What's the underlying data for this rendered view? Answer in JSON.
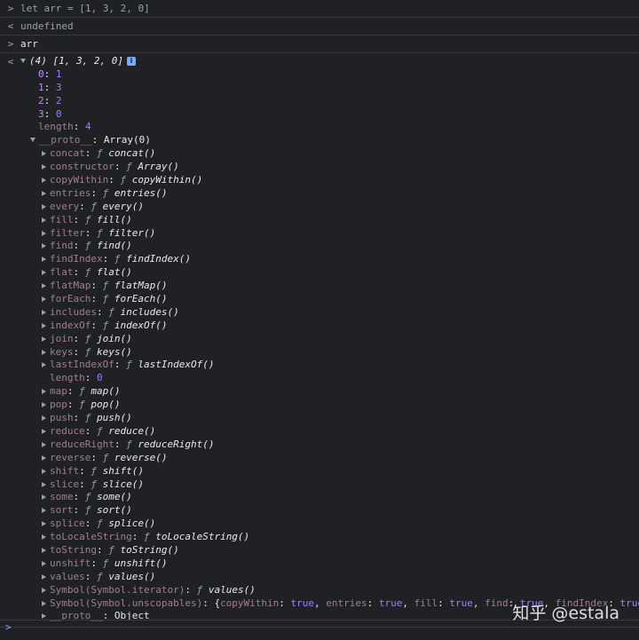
{
  "entries": {
    "input1": {
      "prompt": ">",
      "code_let": "let",
      "code_rest": " arr = [1, 3, 2, 0]"
    },
    "output1": {
      "prompt": "<",
      "text": "undefined"
    },
    "input2": {
      "prompt": ">",
      "text": "arr"
    },
    "output2": {
      "prompt": "<",
      "summary_count": "(4)",
      "summary_array": "[1, 3, 2, 0]",
      "info_badge": "i"
    }
  },
  "array_items": [
    {
      "key": "0",
      "value": "1"
    },
    {
      "key": "1",
      "value": "3"
    },
    {
      "key": "2",
      "value": "2"
    },
    {
      "key": "3",
      "value": "0"
    }
  ],
  "length_row": {
    "key": "length",
    "value": "4"
  },
  "proto": {
    "key": "__proto__",
    "value": "Array(0)"
  },
  "proto_methods": [
    {
      "key": "concat",
      "fn": "concat()"
    },
    {
      "key": "constructor",
      "fn": "Array()"
    },
    {
      "key": "copyWithin",
      "fn": "copyWithin()"
    },
    {
      "key": "entries",
      "fn": "entries()"
    },
    {
      "key": "every",
      "fn": "every()"
    },
    {
      "key": "fill",
      "fn": "fill()"
    },
    {
      "key": "filter",
      "fn": "filter()"
    },
    {
      "key": "find",
      "fn": "find()"
    },
    {
      "key": "findIndex",
      "fn": "findIndex()"
    },
    {
      "key": "flat",
      "fn": "flat()"
    },
    {
      "key": "flatMap",
      "fn": "flatMap()"
    },
    {
      "key": "forEach",
      "fn": "forEach()"
    },
    {
      "key": "includes",
      "fn": "includes()"
    },
    {
      "key": "indexOf",
      "fn": "indexOf()"
    },
    {
      "key": "join",
      "fn": "join()"
    },
    {
      "key": "keys",
      "fn": "keys()"
    },
    {
      "key": "lastIndexOf",
      "fn": "lastIndexOf()"
    }
  ],
  "proto_length": {
    "key": "length",
    "value": "0"
  },
  "proto_methods2": [
    {
      "key": "map",
      "fn": "map()"
    },
    {
      "key": "pop",
      "fn": "pop()"
    },
    {
      "key": "push",
      "fn": "push()"
    },
    {
      "key": "reduce",
      "fn": "reduce()"
    },
    {
      "key": "reduceRight",
      "fn": "reduceRight()"
    },
    {
      "key": "reverse",
      "fn": "reverse()"
    },
    {
      "key": "shift",
      "fn": "shift()"
    },
    {
      "key": "slice",
      "fn": "slice()"
    },
    {
      "key": "some",
      "fn": "some()"
    },
    {
      "key": "sort",
      "fn": "sort()"
    },
    {
      "key": "splice",
      "fn": "splice()"
    },
    {
      "key": "toLocaleString",
      "fn": "toLocaleString()"
    },
    {
      "key": "toString",
      "fn": "toString()"
    },
    {
      "key": "unshift",
      "fn": "unshift()"
    },
    {
      "key": "values",
      "fn": "values()"
    },
    {
      "key": "Symbol(Symbol.iterator)",
      "fn": "values()"
    }
  ],
  "unscopables": {
    "key": "Symbol(Symbol.unscopables)",
    "open": "{",
    "pairs": [
      {
        "k": "copyWithin",
        "v": "true"
      },
      {
        "k": "entries",
        "v": "true"
      },
      {
        "k": "fill",
        "v": "true"
      },
      {
        "k": "find",
        "v": "true"
      },
      {
        "k": "findIndex",
        "v": "true"
      }
    ],
    "tail": "…}"
  },
  "proto2": {
    "key": "__proto__",
    "value": "Object"
  },
  "fn_symbol": "ƒ",
  "watermark": "知乎 @estala",
  "bottom_prompt": ">"
}
